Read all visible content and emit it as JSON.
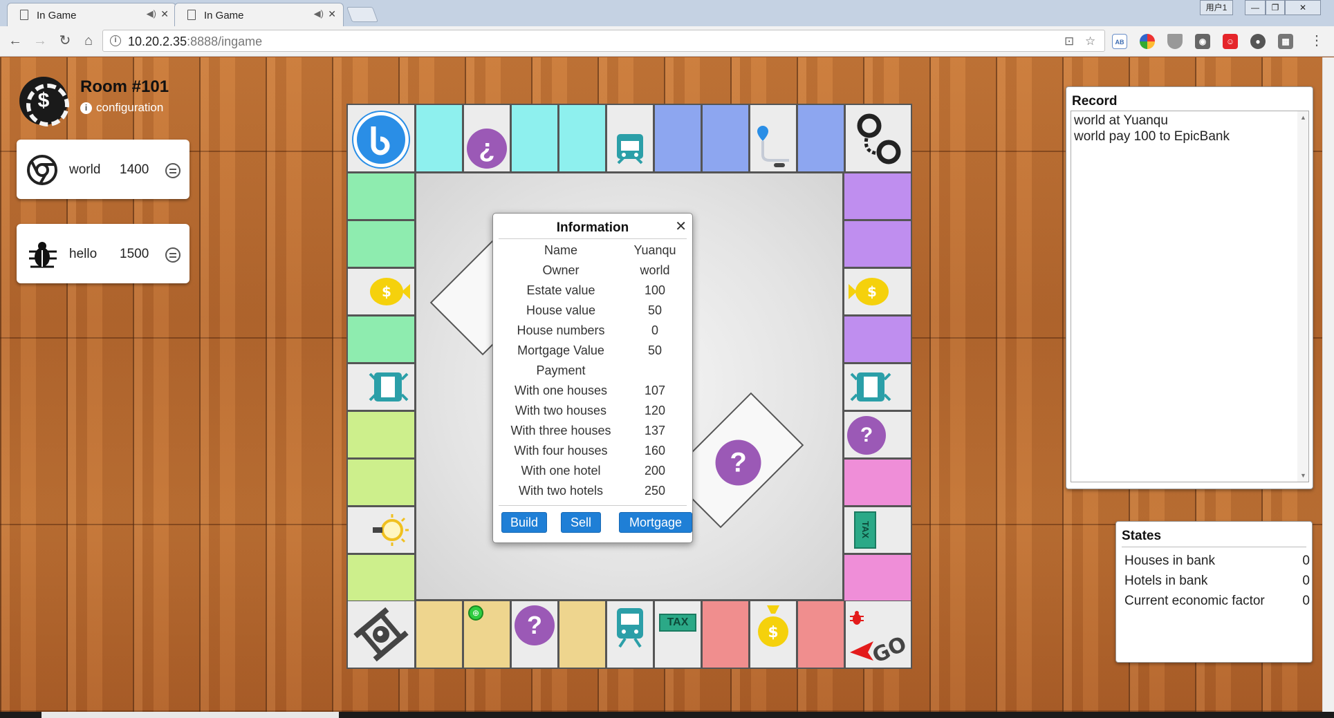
{
  "browser": {
    "tabs": [
      {
        "title": "In Game"
      },
      {
        "title": "In Game"
      }
    ],
    "window_user": "用户1",
    "url_host": "10.20.2.35",
    "url_rest": ":8888/ingame"
  },
  "room": {
    "title": "Room #101",
    "config_label": "configuration"
  },
  "players": [
    {
      "name": "world",
      "money": "1400",
      "avatar": "chrome-icon"
    },
    {
      "name": "hello",
      "money": "1500",
      "avatar": "bug-icon"
    }
  ],
  "board": {
    "colors": {
      "cyan": "#8ef0ee",
      "blue": "#8da6f0",
      "green": "#8eecaf",
      "lime": "#cdef8c",
      "sand": "#eed58e",
      "red": "#f08e8e",
      "pink": "#ef8ed8",
      "purple": "#bf8eef"
    },
    "tax_label": "TAX",
    "go_label": "GO"
  },
  "info": {
    "title": "Information",
    "rows": [
      {
        "k": "Name",
        "v": "Yuanqu"
      },
      {
        "k": "Owner",
        "v": "world"
      },
      {
        "k": "Estate value",
        "v": "100"
      },
      {
        "k": "House value",
        "v": "50"
      },
      {
        "k": "House numbers",
        "v": "0"
      },
      {
        "k": "Mortgage Value",
        "v": "50"
      },
      {
        "k": "Payment",
        "v": ""
      },
      {
        "k": "With one houses",
        "v": "107"
      },
      {
        "k": "With two houses",
        "v": "120"
      },
      {
        "k": "With three houses",
        "v": "137"
      },
      {
        "k": "With four houses",
        "v": "160"
      },
      {
        "k": "With one hotel",
        "v": "200"
      },
      {
        "k": "With two hotels",
        "v": "250"
      }
    ],
    "buttons": {
      "build": "Build",
      "sell": "Sell",
      "mortgage": "Mortgage"
    }
  },
  "record": {
    "title": "Record",
    "lines": [
      "world at Yuanqu",
      "world pay 100 to EpicBank"
    ]
  },
  "states": {
    "title": "States",
    "rows": [
      {
        "k": "Houses in bank",
        "v": "0"
      },
      {
        "k": "Hotels in bank",
        "v": "0"
      },
      {
        "k": "Current economic factor",
        "v": "0"
      }
    ]
  }
}
